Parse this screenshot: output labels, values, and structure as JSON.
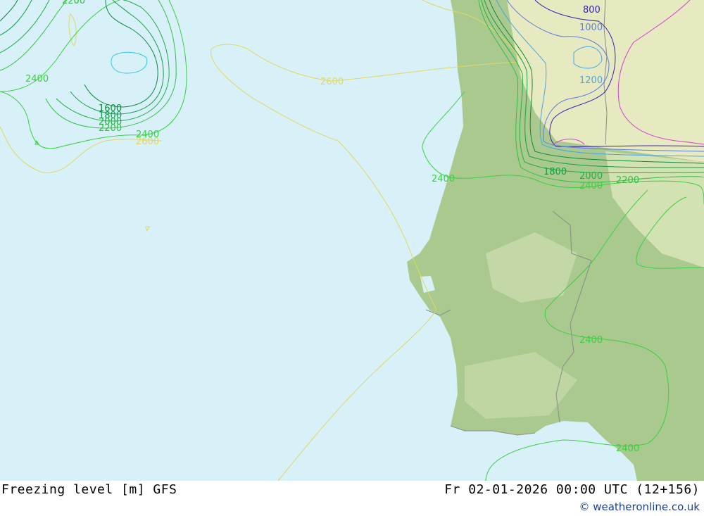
{
  "footer": {
    "product": "Freezing level [m] GFS",
    "valid_time": "Fr 02-01-2026 00:00 UTC (12+156)",
    "credit": "© weatheronline.co.uk"
  },
  "colors": {
    "sea": "#d8f0f8",
    "land": "#a9c98f",
    "land_high": "#f2efc9",
    "c800": "#3a1fb5",
    "c1000": "#5a7de0",
    "c1200": "#4aa3e8",
    "c1600": "#0a8a3a",
    "c1800": "#10a040",
    "c2000": "#20b040",
    "c2200": "#30c040",
    "c2400": "#3ad040",
    "c2600": "#e0d860",
    "cpink": "#d040d0"
  },
  "contour_labels": {
    "l2200_top": "2200",
    "l2400_nw": "2400",
    "l1600": "1600",
    "l1800": "1800",
    "l2000": "2000",
    "l2200": "2200",
    "l2400_a": "2400",
    "l2600_a": "2600",
    "l2600_b": "2600",
    "l800": "800",
    "l1000": "1000",
    "l1200": "1200",
    "l2400_coast": "2400",
    "l1800_e": "1800",
    "l2000_e": "2000",
    "l2200_e": "2200",
    "l2400_e": "2400",
    "l2400_mid": "2400",
    "l2400_s": "2400"
  }
}
